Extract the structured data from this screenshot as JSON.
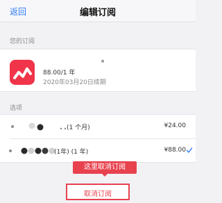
{
  "nav": {
    "back_label": "返回",
    "title": "编辑订阅"
  },
  "subscription": {
    "section_label": "您的订阅",
    "price": "88.00/1 年",
    "renewal": "2020年03月20日续期"
  },
  "options": {
    "section_label": "选项",
    "items": [
      {
        "name": "(1 个月)",
        "price": "¥24.00",
        "selected": false
      },
      {
        "name": "(1年)  (1 年)",
        "price": "¥88.00",
        "selected": true
      }
    ]
  },
  "callout": {
    "text": "这里取消订阅"
  },
  "cancel": {
    "label": "取消订阅"
  },
  "colors": {
    "accent": "#2d7bf6",
    "highlight": "#e8424f",
    "app_icon": "#f0344a"
  }
}
